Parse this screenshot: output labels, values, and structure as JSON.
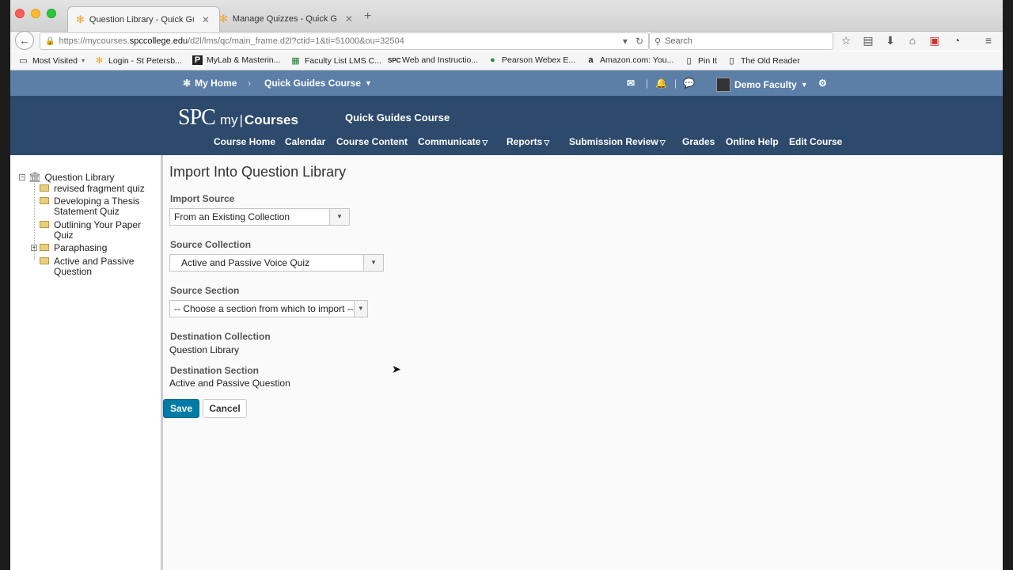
{
  "browser": {
    "tabs": [
      {
        "label": "Question Library - Quick Gu...",
        "active": true
      },
      {
        "label": "Manage Quizzes - Quick Gu...",
        "active": false
      }
    ],
    "url_prefix": "https://mycourses.",
    "url_domain": "spccollege.edu",
    "url_path": "/d2l/lms/qc/main_frame.d2l?ctid=1&ti=51000&ou=32504",
    "search_placeholder": "Search",
    "bookmarks": [
      "Most Visited",
      "Login - St Petersb...",
      "MyLab & Masterin...",
      "Faculty List LMS C...",
      "Web and Instructio...",
      "Pearson Webex E...",
      "Amazon.com: You...",
      "Pin It",
      "The Old Reader"
    ]
  },
  "minibar": {
    "home": "My Home",
    "course": "Quick Guides Course",
    "user": "Demo Faculty"
  },
  "banner": {
    "logo_spc": "SPC",
    "logo_my": "my",
    "logo_courses": "Courses",
    "course_name": "Quick Guides Course",
    "nav": [
      "Course Home",
      "Calendar",
      "Course Content",
      "Communicate",
      "Reports",
      "Submission Review",
      "Grades",
      "Online Help",
      "Edit Course"
    ]
  },
  "sidebar": {
    "root": "Question Library",
    "items": [
      "revised fragment quiz",
      "Developing a Thesis Statement Quiz",
      "Outlining Your Paper Quiz",
      "Paraphasing",
      "Active and Passive Question"
    ]
  },
  "form": {
    "title": "Import Into Question Library",
    "import_source_label": "Import Source",
    "import_source_value": "From an Existing Collection",
    "source_collection_label": "Source Collection",
    "source_collection_value": "Active and Passive Voice Quiz",
    "source_section_label": "Source Section",
    "source_section_value": "-- Choose a section from which to import --",
    "dest_collection_label": "Destination Collection",
    "dest_collection_value": "Question Library",
    "dest_section_label": "Destination Section",
    "dest_section_value": "Active and Passive Question",
    "save_label": "Save",
    "cancel_label": "Cancel"
  },
  "colors": {
    "minibar": "#5c7fa8",
    "banner": "#2d4a6c",
    "save_button": "#007ba5"
  }
}
